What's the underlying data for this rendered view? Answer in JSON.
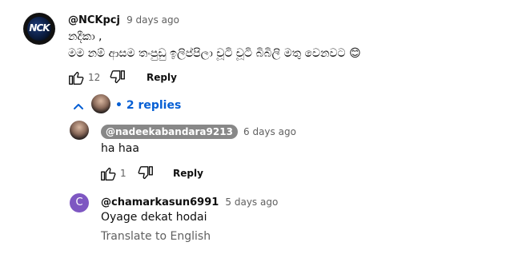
{
  "comment": {
    "author": "@NCKpcj",
    "avatar_text": "NCK",
    "time": "9 days ago",
    "lines": [
      "නදීකා ,",
      "මම නම් ආසම තංපුඩු ඉලිප්පිලා චූටි චූටි බිබිලි මතු වෙනවට 😊"
    ],
    "like_count": "12",
    "reply_label": "Reply",
    "replies_link": "• 2 replies"
  },
  "replies": [
    {
      "author": "@nadeekabandara9213",
      "time": "6 days ago",
      "text": "ha haa",
      "like_count": "1",
      "reply_label": "Reply"
    },
    {
      "author": "@chamarkasun6991",
      "avatar_letter": "C",
      "time": "5 days ago",
      "text": "Oyage dekat hodai",
      "translate_label": "Translate to English"
    }
  ],
  "colors": {
    "link": "#065fd4",
    "secondary_text": "#606060",
    "avatar_c": "#7e57c2",
    "chip": "#888888"
  }
}
